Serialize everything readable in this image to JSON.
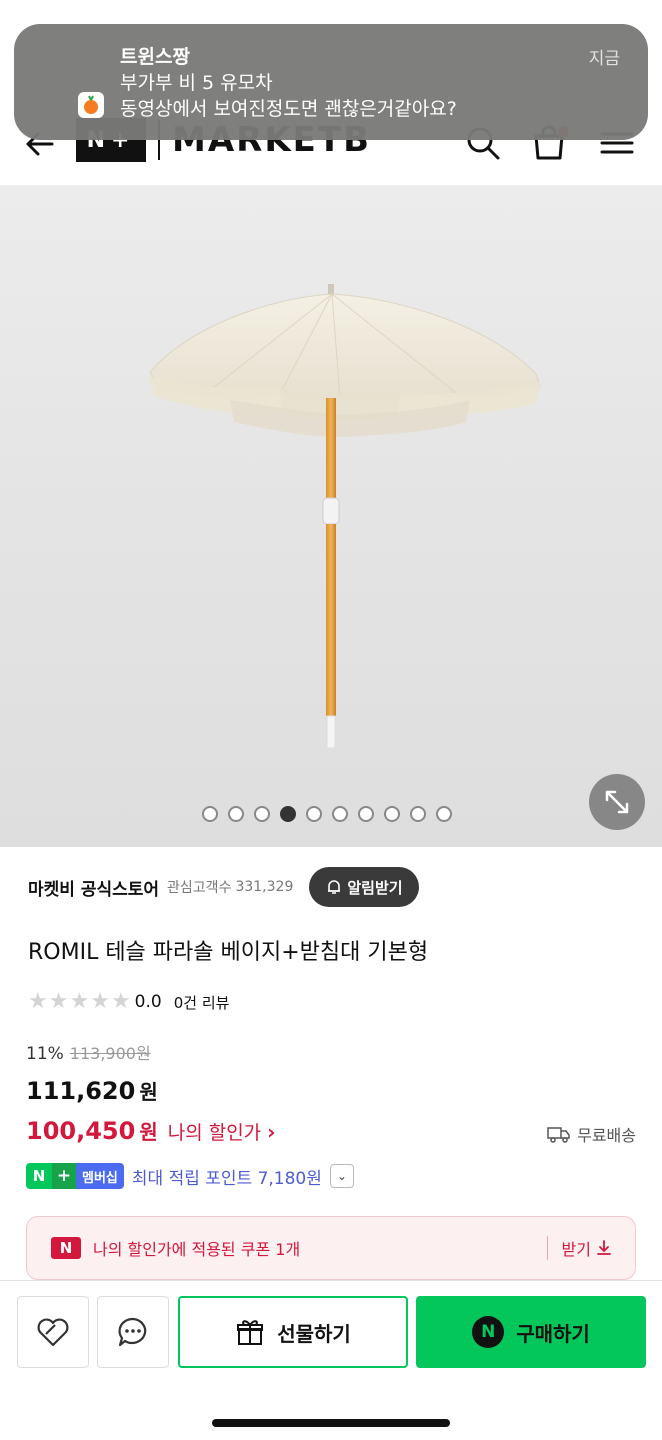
{
  "notification": {
    "title": "트윈스짱",
    "subtitle": "부가부 비 5 유모차",
    "body": "동영상에서 보여진정도면 괜찮은거같아요?",
    "time": "지금"
  },
  "header": {
    "logo_box": "N+",
    "logo_text": "MARKETB",
    "icons": [
      "back-arrow-icon",
      "search-icon",
      "cart-icon",
      "menu-icon"
    ]
  },
  "gallery": {
    "dot_count": 10,
    "active_index": 3
  },
  "store": {
    "name": "마켓비 공식스토어",
    "follow_label": "관심고객수",
    "follow_count": "331,329",
    "alarm_button": "알림받기"
  },
  "product": {
    "name": "ROMIL 테슬 파라솔 베이지+받침대 기본형",
    "rating": "0.0",
    "review_count": "0건 리뷰",
    "discount_rate": "11%",
    "original_price": "113,900원",
    "sale_price": "111,620",
    "currency": "원",
    "my_price": "100,450",
    "my_price_label": "나의 할인가",
    "shipping": "무료배송"
  },
  "membership": {
    "badge_n": "N",
    "badge_plus": "+",
    "badge_label": "멤버십",
    "text": "최대 적립 포인트 7,180원"
  },
  "coupon": {
    "badge": "N",
    "text": "나의 할인가에 적용된 쿠폰 1개",
    "get_label": "받기"
  },
  "bottom_bar": {
    "gift_label": "선물하기",
    "buy_label": "구매하기",
    "buy_badge": "N"
  },
  "colors": {
    "naver_green": "#03c75a",
    "discount_red": "#d3173d",
    "membership_blue": "#4e5ccf"
  }
}
